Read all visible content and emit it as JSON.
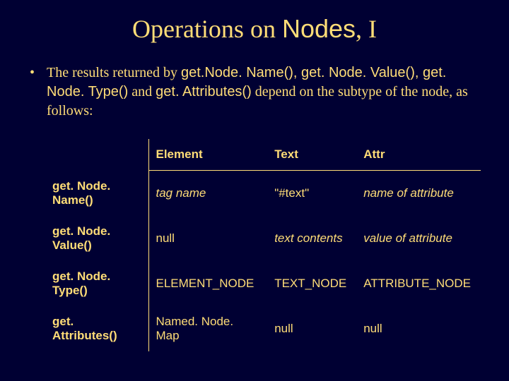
{
  "title": {
    "pre": "Operations on ",
    "nodes": "Nodes",
    "post": ", I"
  },
  "bullet": {
    "dot": "•",
    "seg1": "The results returned by ",
    "code1": "get.Node. Name(), ",
    "code2": "get. Node. Value(), ",
    "code3": "get. Node. Type()",
    "seg2": " and ",
    "code4": "get. Attributes()",
    "seg3": " depend on the subtype of the node, as follows:"
  },
  "table": {
    "head": {
      "blank": "",
      "c1": "Element",
      "c2": "Text",
      "c3": "Attr"
    },
    "rows": [
      {
        "label": "get. Node. Name()",
        "c1": "tag name",
        "c1_italic": true,
        "c2": "\"#text\"",
        "c2_italic": false,
        "c3": "name of attribute",
        "c3_italic": true
      },
      {
        "label": "get. Node. Value()",
        "c1": "null",
        "c1_italic": false,
        "c2": "text contents",
        "c2_italic": true,
        "c3": "value of attribute",
        "c3_italic": true
      },
      {
        "label": "get. Node. Type()",
        "c1": "ELEMENT_NODE",
        "c1_italic": false,
        "c2": "TEXT_NODE",
        "c2_italic": false,
        "c3": "ATTRIBUTE_NODE",
        "c3_italic": false
      },
      {
        "label": "get. Attributes()",
        "c1": "Named. Node. Map",
        "c1_italic": false,
        "c2": "null",
        "c2_italic": false,
        "c3": "null",
        "c3_italic": false
      }
    ]
  }
}
